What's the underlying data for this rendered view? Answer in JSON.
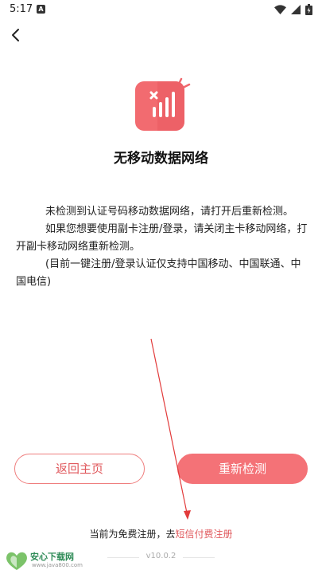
{
  "status_bar": {
    "time": "5:17",
    "notification_badge": "A"
  },
  "page": {
    "title": "无移动数据网络",
    "paragraphs": [
      "未检测到认证号码移动数据网络，请打开后重新检测。",
      "如果您想要使用副卡注册/登录，请关闭主卡移动网络，打开副卡移动网络重新检测。",
      "(目前一键注册/登录认证仅支持中国移动、中国联通、中国电信)"
    ]
  },
  "buttons": {
    "home_label": "返回主页",
    "retry_label": "重新检测"
  },
  "footer": {
    "note_prefix": "当前为免费注册，去",
    "note_link": "短信付费注册",
    "version": "v10.0.2"
  },
  "watermark": {
    "title": "安心下载网",
    "url": "www.java800.com"
  },
  "colors": {
    "accent": "#f47277",
    "accent_text": "#e0585c",
    "arrow": "#e23b3b"
  },
  "icons": [
    "back-arrow-icon",
    "no-signal-icon",
    "wifi-icon",
    "battery-icon",
    "signal-icon"
  ]
}
